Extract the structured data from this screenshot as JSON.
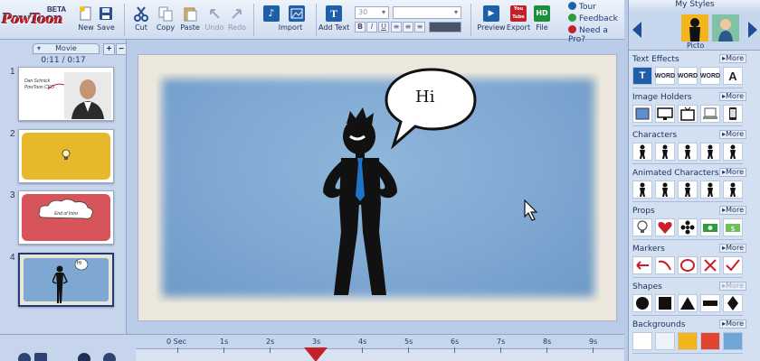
{
  "app": {
    "logo_text": "PowToon",
    "beta_label": "BETA"
  },
  "toolbar": {
    "new_label": "New",
    "save_label": "Save",
    "cut_label": "Cut",
    "copy_label": "Copy",
    "paste_label": "Paste",
    "undo_label": "Undo",
    "redo_label": "Redo",
    "import_label": "Import",
    "add_text_label": "Add Text",
    "font_size_value": "30",
    "format_bold": "B",
    "format_italic": "I",
    "format_underline": "U",
    "preview_label": "Preview",
    "export_label": "Export",
    "file_label": "File",
    "youtube_badge": "You Tube",
    "hd_badge": "HD",
    "help": {
      "tour": "Tour",
      "feedback": "Feedback",
      "pro": "Need a Pro?"
    },
    "colors": {
      "tour": "#1f5fa8",
      "feedback": "#2e9b3f",
      "pro": "#c32127"
    }
  },
  "left": {
    "movie_tab_label": "Movie",
    "add_btn": "+",
    "collapse_btn": "−",
    "movie_time": "0:11 / 0:17",
    "slides": [
      {
        "num": "1",
        "line1": "Dan Schnick",
        "line2": "PowToon CEO"
      },
      {
        "num": "2"
      },
      {
        "num": "3",
        "cloud_text": "End of Intro"
      },
      {
        "num": "4",
        "bubble_text": "Hi"
      }
    ]
  },
  "stage": {
    "speech_text": "Hi",
    "canvas_color": "#7ea8d2"
  },
  "right": {
    "title": "My Styles",
    "style_name": "Picto",
    "sections": [
      {
        "title": "Text Effects",
        "more": "More",
        "icons": [
          "text-box-icon",
          "text-sticker-icon",
          "text-word-icon",
          "text-word-icon",
          "text-a-icon"
        ],
        "labels": [
          "T",
          "WORD",
          "WORD",
          "WORD",
          "A"
        ]
      },
      {
        "title": "Image Holders",
        "more": "More",
        "icons": [
          "picture-frame-icon",
          "monitor-icon",
          "tv-icon",
          "laptop-icon",
          "phone-icon"
        ]
      },
      {
        "title": "Characters",
        "more": "More",
        "icons": [
          "figure-icon",
          "figure-icon",
          "figure-icon",
          "figure-icon",
          "figure-icon"
        ]
      },
      {
        "title": "Animated Characters",
        "more": "More",
        "icons": [
          "figure-icon",
          "figure-icon",
          "figure-icon",
          "figure-icon",
          "figure-icon"
        ]
      },
      {
        "title": "Props",
        "more": "More",
        "icons": [
          "lightbulb-icon",
          "heart-icon",
          "flower-icon",
          "money-icon",
          "dollar-icon"
        ]
      },
      {
        "title": "Markers",
        "more": "More",
        "icons": [
          "arrow-icon",
          "curve-arrow-icon",
          "circle-marker-icon",
          "x-marker-icon",
          "check-marker-icon"
        ]
      },
      {
        "title": "Shapes",
        "more": "More",
        "icons": [
          "circle-shape-icon",
          "square-shape-icon",
          "triangle-shape-icon",
          "rectangle-shape-icon",
          "diamond-shape-icon"
        ]
      },
      {
        "title": "Backgrounds",
        "more": "More",
        "icons": [
          "bg-white-icon",
          "bg-grid-icon",
          "bg-yellow-icon",
          "bg-red-icon",
          "bg-blue-icon"
        ]
      }
    ],
    "bg_colors": [
      "#ffffff",
      "#eef2f8",
      "#f3b51c",
      "#e2452f",
      "#6fa6d6"
    ]
  },
  "timeline": {
    "ticks": [
      "0 Sec",
      "1s",
      "2s",
      "3s",
      "4s",
      "5s",
      "6s",
      "7s",
      "8s",
      "9s"
    ],
    "playhead_seconds": 3.0
  }
}
